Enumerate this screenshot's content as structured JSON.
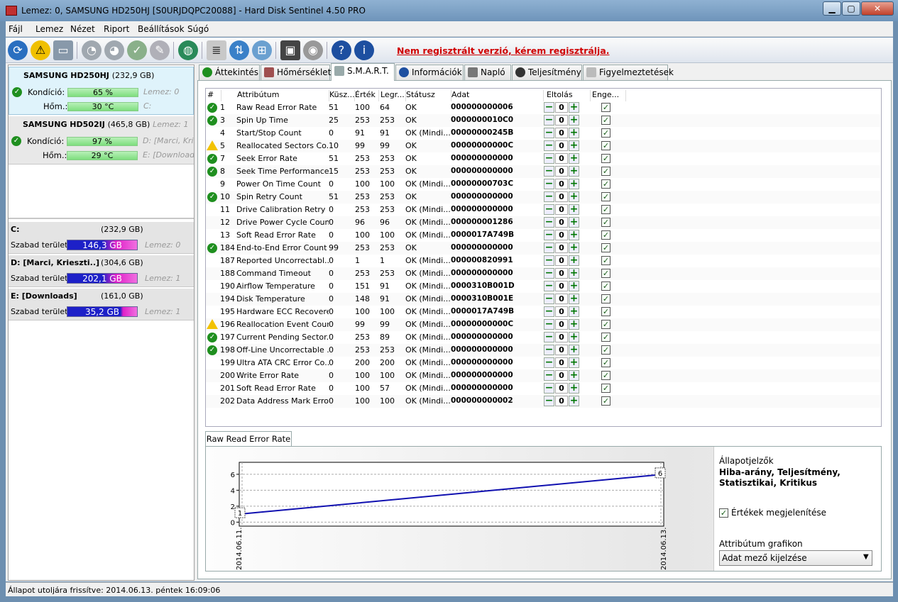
{
  "window": {
    "title": "Lemez: 0, SAMSUNG HD250HJ [S0URJDQPC20088]  -  Hard Disk Sentinel 4.50 PRO"
  },
  "menu": [
    "Fájl",
    "Lemez",
    "Nézet",
    "Riport",
    "Beállítások",
    "Súgó"
  ],
  "toolbar": {
    "register_link": "Nem regisztrált verzió, kérem regisztrálja."
  },
  "disks": [
    {
      "name": "SAMSUNG HD250HJ",
      "size": "(232,9 GB)",
      "condition_label": "Kondíció:",
      "condition": "65 %",
      "condition_pct": 65,
      "temp_label": "Hőm.:",
      "temp": "30 °C",
      "extra1": "Lemez: 0",
      "extra2": "C:"
    },
    {
      "name": "SAMSUNG HD502IJ",
      "size": "(465,8 GB)",
      "extra0": "Lemez: 1",
      "condition_label": "Kondíció:",
      "condition": "97 %",
      "condition_pct": 97,
      "temp_label": "Hőm.:",
      "temp": "29 °C",
      "extra1": "D: [Marci, Kris",
      "extra2": "E: [Download"
    }
  ],
  "volumes": [
    {
      "name": "C:",
      "size": "(232,9 GB)",
      "free_label": "Szabad terület",
      "free": "146,3 GB",
      "disk": "Lemez: 0"
    },
    {
      "name": "D: [Marci, Krieszti..]",
      "size": "(304,6 GB)",
      "free_label": "Szabad terület",
      "free": "202,1 GB",
      "disk": "Lemez: 1"
    },
    {
      "name": "E: [Downloads]",
      "size": "(161,0 GB)",
      "free_label": "Szabad terület",
      "free": "35,2 GB",
      "disk": "Lemez: 1"
    }
  ],
  "tabs": [
    "Áttekintés",
    "Hőmérséklet",
    "S.M.A.R.T.",
    "Információk",
    "Napló",
    "Teljesítmény",
    "Figyelmeztetések"
  ],
  "smart_headers": [
    "#",
    "Attribútum",
    "Küsz...",
    "Érték",
    "Legr...",
    "Státusz",
    "Adat",
    "Eltolás",
    "Enge..."
  ],
  "smart_rows": [
    {
      "icon": "ok",
      "id": "1",
      "name": "Raw Read Error Rate",
      "thr": "51",
      "val": "100",
      "worst": "64",
      "status": "OK",
      "data": "000000000006",
      "offset": "0"
    },
    {
      "icon": "ok",
      "id": "3",
      "name": "Spin Up Time",
      "thr": "25",
      "val": "253",
      "worst": "253",
      "status": "OK",
      "data": "0000000010C0",
      "offset": "0"
    },
    {
      "icon": "",
      "id": "4",
      "name": "Start/Stop Count",
      "thr": "0",
      "val": "91",
      "worst": "91",
      "status": "OK (Mindi...",
      "data": "00000000245B",
      "offset": "0"
    },
    {
      "icon": "warn",
      "id": "5",
      "name": "Reallocated Sectors Co...",
      "thr": "10",
      "val": "99",
      "worst": "99",
      "status": "OK",
      "data": "00000000000C",
      "offset": "0"
    },
    {
      "icon": "ok",
      "id": "7",
      "name": "Seek Error Rate",
      "thr": "51",
      "val": "253",
      "worst": "253",
      "status": "OK",
      "data": "000000000000",
      "offset": "0"
    },
    {
      "icon": "ok",
      "id": "8",
      "name": "Seek Time Performance",
      "thr": "15",
      "val": "253",
      "worst": "253",
      "status": "OK",
      "data": "000000000000",
      "offset": "0"
    },
    {
      "icon": "",
      "id": "9",
      "name": "Power On Time Count",
      "thr": "0",
      "val": "100",
      "worst": "100",
      "status": "OK (Mindi...",
      "data": "00000000703C",
      "offset": "0"
    },
    {
      "icon": "ok",
      "id": "10",
      "name": "Spin Retry Count",
      "thr": "51",
      "val": "253",
      "worst": "253",
      "status": "OK",
      "data": "000000000000",
      "offset": "0"
    },
    {
      "icon": "",
      "id": "11",
      "name": "Drive Calibration Retry ...",
      "thr": "0",
      "val": "253",
      "worst": "253",
      "status": "OK (Mindi...",
      "data": "000000000000",
      "offset": "0"
    },
    {
      "icon": "",
      "id": "12",
      "name": "Drive Power Cycle Count",
      "thr": "0",
      "val": "96",
      "worst": "96",
      "status": "OK (Mindi...",
      "data": "000000001286",
      "offset": "0"
    },
    {
      "icon": "",
      "id": "13",
      "name": "Soft Read Error Rate",
      "thr": "0",
      "val": "100",
      "worst": "100",
      "status": "OK (Mindi...",
      "data": "0000017A749B",
      "offset": "0"
    },
    {
      "icon": "ok",
      "id": "184",
      "name": "End-to-End Error Count",
      "thr": "99",
      "val": "253",
      "worst": "253",
      "status": "OK",
      "data": "000000000000",
      "offset": "0"
    },
    {
      "icon": "",
      "id": "187",
      "name": "Reported Uncorrectabl...",
      "thr": "0",
      "val": "1",
      "worst": "1",
      "status": "OK (Mindi...",
      "data": "000000820991",
      "offset": "0"
    },
    {
      "icon": "",
      "id": "188",
      "name": "Command Timeout",
      "thr": "0",
      "val": "253",
      "worst": "253",
      "status": "OK (Mindi...",
      "data": "000000000000",
      "offset": "0"
    },
    {
      "icon": "",
      "id": "190",
      "name": "Airflow Temperature",
      "thr": "0",
      "val": "151",
      "worst": "91",
      "status": "OK (Mindi...",
      "data": "0000310B001D",
      "offset": "0"
    },
    {
      "icon": "",
      "id": "194",
      "name": "Disk Temperature",
      "thr": "0",
      "val": "148",
      "worst": "91",
      "status": "OK (Mindi...",
      "data": "0000310B001E",
      "offset": "0"
    },
    {
      "icon": "",
      "id": "195",
      "name": "Hardware ECC Recovered",
      "thr": "0",
      "val": "100",
      "worst": "100",
      "status": "OK (Mindi...",
      "data": "0000017A749B",
      "offset": "0"
    },
    {
      "icon": "warn",
      "id": "196",
      "name": "Reallocation Event Count",
      "thr": "0",
      "val": "99",
      "worst": "99",
      "status": "OK (Mindi...",
      "data": "00000000000C",
      "offset": "0"
    },
    {
      "icon": "ok",
      "id": "197",
      "name": "Current Pending Sector...",
      "thr": "0",
      "val": "253",
      "worst": "89",
      "status": "OK (Mindi...",
      "data": "000000000000",
      "offset": "0"
    },
    {
      "icon": "ok",
      "id": "198",
      "name": "Off-Line Uncorrectable ...",
      "thr": "0",
      "val": "253",
      "worst": "253",
      "status": "OK (Mindi...",
      "data": "000000000000",
      "offset": "0"
    },
    {
      "icon": "",
      "id": "199",
      "name": "Ultra ATA CRC Error Co...",
      "thr": "0",
      "val": "200",
      "worst": "200",
      "status": "OK (Mindi...",
      "data": "000000000000",
      "offset": "0"
    },
    {
      "icon": "",
      "id": "200",
      "name": "Write Error Rate",
      "thr": "0",
      "val": "100",
      "worst": "100",
      "status": "OK (Mindi...",
      "data": "000000000000",
      "offset": "0"
    },
    {
      "icon": "",
      "id": "201",
      "name": "Soft Read Error Rate",
      "thr": "0",
      "val": "100",
      "worst": "57",
      "status": "OK (Mindi...",
      "data": "000000000000",
      "offset": "0"
    },
    {
      "icon": "",
      "id": "202",
      "name": "Data Address Mark Errors",
      "thr": "0",
      "val": "100",
      "worst": "100",
      "status": "OK (Mindi...",
      "data": "000000000002",
      "offset": "0"
    }
  ],
  "chart_tab": "Raw Read Error Rate",
  "chart_data": {
    "type": "line",
    "x": [
      "2014.06.11.",
      "2014.06.13."
    ],
    "values": [
      1,
      6
    ],
    "ylim": [
      -0.5,
      7.5
    ],
    "yticks": [
      "0",
      "2",
      "4",
      "6"
    ],
    "point_labels": [
      "1",
      "6"
    ],
    "color": "#1010b0"
  },
  "indicators": {
    "title": "Állapotjelzők",
    "value": "Hiba-arány, Teljesítmény, Statisztikai, Kritikus",
    "show_values": "Értékek megjelenítése",
    "graph_label": "Attribútum grafikon",
    "graph_select": "Adat mező kijelzése"
  },
  "status": "Állapot utoljára frissítve: 2014.06.13. péntek 16:09:06",
  "colors": {
    "accent_red": "#d00000",
    "ok_green": "#1f8f1f",
    "warn_yellow": "#f2c200"
  }
}
